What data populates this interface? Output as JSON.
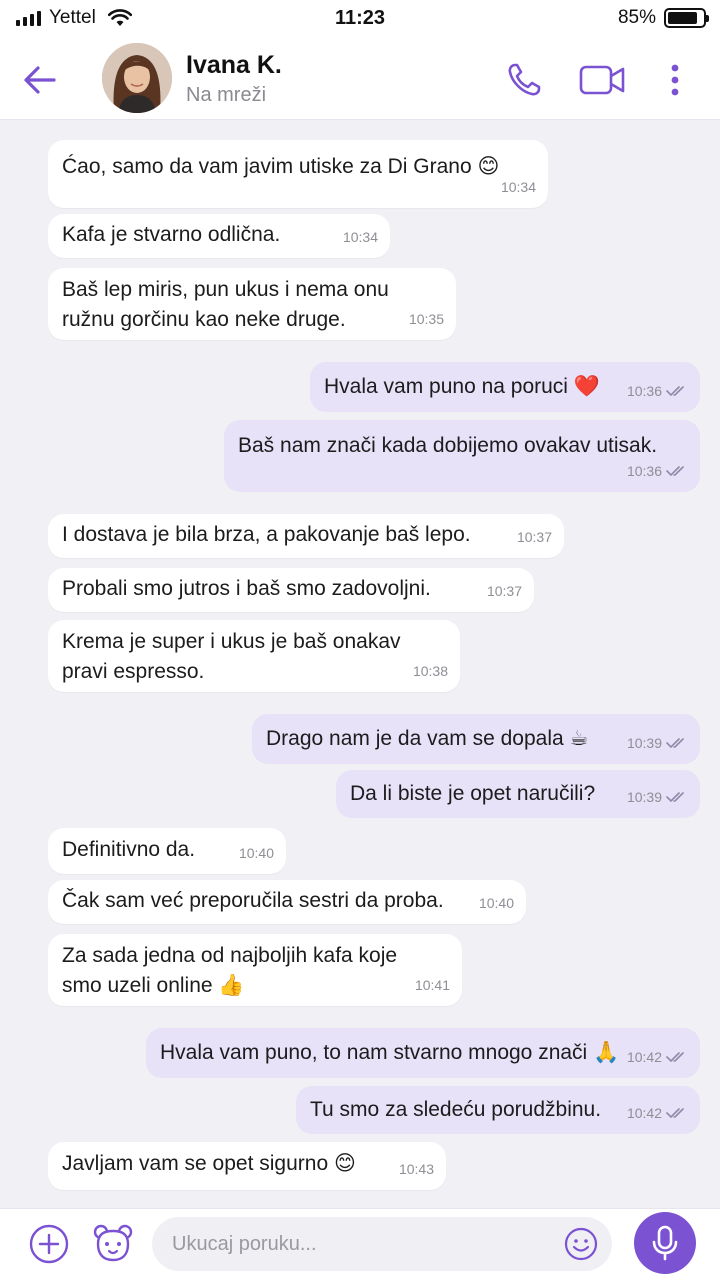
{
  "status_bar": {
    "carrier": "Yettel",
    "time": "11:23",
    "battery_percent": "85%",
    "battery_level": 0.85,
    "icons": [
      "signal-icon",
      "wifi-icon",
      "battery-icon"
    ]
  },
  "header": {
    "contact_name": "Ivana K.",
    "contact_status": "Na mreži",
    "icons": [
      "back-arrow-icon",
      "phone-icon",
      "video-icon",
      "more-vertical-icon"
    ]
  },
  "colors": {
    "accent": "#7b52d1",
    "outgoing_bubble": "#e7e2f7",
    "incoming_bubble": "#ffffff",
    "background": "#f1f0f5"
  },
  "messages": [
    {
      "direction": "in",
      "text": "Ćao, samo da vam javim utiske za Di Grano 😊",
      "time": "10:34"
    },
    {
      "direction": "in",
      "text": "Kafa je stvarno odlična.",
      "time": "10:34"
    },
    {
      "direction": "in",
      "text": "Baš lep miris, pun ukus i nema onu\nružnu gorčinu kao neke druge.",
      "time": "10:35"
    },
    {
      "direction": "out",
      "text": "Hvala vam puno na poruci ❤️",
      "time": "10:36",
      "status": "read"
    },
    {
      "direction": "out",
      "text": "Baš nam znači kada dobijemo ovakav utisak.",
      "time": "10:36",
      "status": "read"
    },
    {
      "direction": "in",
      "text": "I dostava je bila brza, a pakovanje baš lepo.",
      "time": "10:37"
    },
    {
      "direction": "in",
      "text": "Probali smo jutros i baš smo zadovoljni.",
      "time": "10:37"
    },
    {
      "direction": "in",
      "text": "Krema je super i ukus je baš onakav\npravi espresso.",
      "time": "10:38"
    },
    {
      "direction": "out",
      "text": "Drago nam je da vam se dopala ☕",
      "time": "10:39",
      "status": "read"
    },
    {
      "direction": "out",
      "text": "Da li biste je opet naručili?",
      "time": "10:39",
      "status": "read"
    },
    {
      "direction": "in",
      "text": "Definitivno da.",
      "time": "10:40"
    },
    {
      "direction": "in",
      "text": "Čak sam već preporučila sestri da proba.",
      "time": "10:40"
    },
    {
      "direction": "in",
      "text": "Za sada jedna od najboljih kafa koje\nsmo uzeli online 👍",
      "time": "10:41"
    },
    {
      "direction": "out",
      "text": "Hvala vam puno, to nam stvarno mnogo znači 🙏",
      "time": "10:42",
      "status": "read"
    },
    {
      "direction": "out",
      "text": "Tu smo za sledeću porudžbinu.",
      "time": "10:42",
      "status": "read"
    },
    {
      "direction": "in",
      "text": "Javljam vam se opet sigurno 😊",
      "time": "10:43"
    }
  ],
  "composer": {
    "placeholder": "Ukucaj poruku...",
    "icons": [
      "plus-icon",
      "sticker-bear-icon",
      "emoji-icon",
      "microphone-icon"
    ]
  }
}
